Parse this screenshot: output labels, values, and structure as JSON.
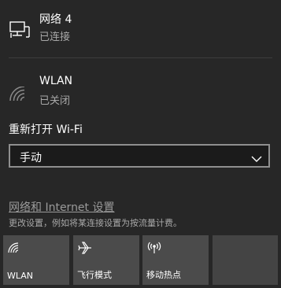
{
  "networks": [
    {
      "name": "网络 4",
      "status": "已连接",
      "icon": "ethernet-icon"
    },
    {
      "name": "WLAN",
      "status": "已关闭",
      "icon": "wifi-icon"
    }
  ],
  "wifi_reopen": {
    "label": "重新打开 Wi-Fi",
    "selected": "手动"
  },
  "settings": {
    "link_text": "网络和 Internet 设置",
    "description": "更改设置，例如将某连接设置为按流量计费。"
  },
  "quick_actions": [
    {
      "label": "WLAN",
      "icon": "wifi-icon"
    },
    {
      "label": "飞行模式",
      "icon": "airplane-icon"
    },
    {
      "label": "移动热点",
      "icon": "hotspot-icon"
    }
  ],
  "colors": {
    "background": "#272727",
    "tile": "#4b4b4b",
    "secondary_text": "#a8a8a8"
  }
}
